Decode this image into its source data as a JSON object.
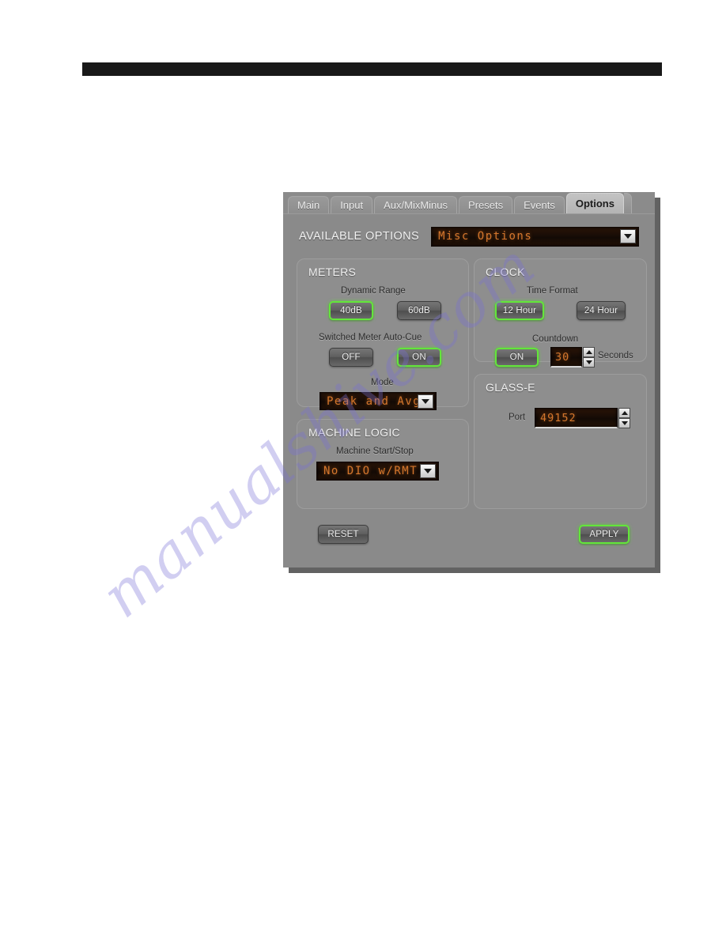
{
  "page": {
    "watermark": "manualshive.com"
  },
  "dialog": {
    "tabs": [
      {
        "label": "Main",
        "active": false
      },
      {
        "label": "Input",
        "active": false
      },
      {
        "label": "Aux/MixMinus",
        "active": false
      },
      {
        "label": "Presets",
        "active": false
      },
      {
        "label": "Events",
        "active": false
      },
      {
        "label": "Options",
        "active": true
      }
    ],
    "available_options": {
      "label": "AVAILABLE OPTIONS",
      "selected": "Misc Options"
    },
    "meters": {
      "title": "METERS",
      "dynamic_range": {
        "label": "Dynamic Range",
        "options": [
          {
            "label": "40dB",
            "selected": true
          },
          {
            "label": "60dB",
            "selected": false
          }
        ]
      },
      "auto_cue": {
        "label": "Switched Meter Auto-Cue",
        "options": [
          {
            "label": "OFF",
            "selected": false
          },
          {
            "label": "ON",
            "selected": true
          }
        ]
      },
      "mode": {
        "label": "Mode",
        "selected": "Peak and Avg"
      }
    },
    "machine_logic": {
      "title": "MACHINE LOGIC",
      "start_stop": {
        "label": "Machine Start/Stop",
        "selected": "No DIO w/RMT"
      }
    },
    "clock": {
      "title": "CLOCK",
      "time_format": {
        "label": "Time Format",
        "options": [
          {
            "label": "12 Hour",
            "selected": true
          },
          {
            "label": "24 Hour",
            "selected": false
          }
        ]
      },
      "countdown": {
        "label": "Countdown",
        "toggle": {
          "label": "ON",
          "selected": true
        },
        "value": "30",
        "units": "Seconds"
      }
    },
    "glass_e": {
      "title": "GLASS-E",
      "port": {
        "label": "Port",
        "value": "49152"
      }
    },
    "footer": {
      "reset_label": "RESET",
      "apply_label": "APPLY"
    },
    "colors": {
      "accent_green": "#63e63a",
      "lcd_orange": "#d4762c",
      "panel_gray": "#8a8a8a",
      "watermark_purple": "#7870d6"
    }
  }
}
